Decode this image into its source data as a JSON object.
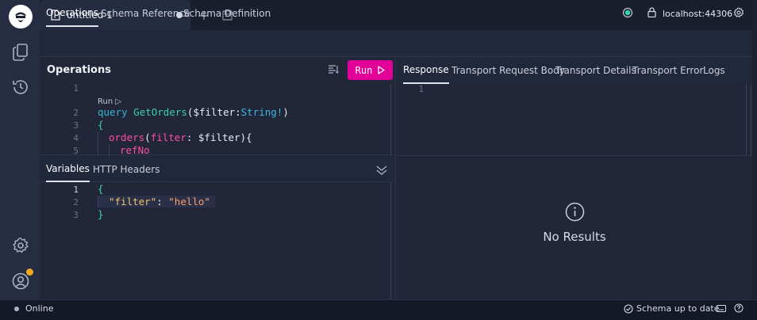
{
  "tab": {
    "title": "untitled 1"
  },
  "top_actions": {
    "add": "+",
    "more": "◦◦◦"
  },
  "subtabs": [
    "Operations",
    "Schema Reference",
    "Schema Definition"
  ],
  "connection": {
    "url": "localhost:44306"
  },
  "operations": {
    "title": "Operations",
    "run_label": "Run",
    "codelens": "Run ▷",
    "lines": [
      "1",
      "2",
      "3",
      "4",
      "5"
    ],
    "code": {
      "kw_query": "query",
      "op_name": "GetOrders",
      "paren_open": "(",
      "var_name": "$filter",
      "colon": ":",
      "type_name": "String!",
      "paren_close": ")",
      "brace_open": "{",
      "field_orders": "orders",
      "arg_open": "(",
      "arg_name": "filter",
      "arg_colon": ": ",
      "arg_var": "$filter",
      "arg_close": "){",
      "field_refno": "refNo"
    }
  },
  "variables": {
    "tabs": [
      "Variables",
      "HTTP Headers"
    ],
    "lines": [
      "1",
      "2",
      "3"
    ],
    "open": "{",
    "key": "\"filter\"",
    "sep": ": ",
    "value": "\"hello\"",
    "close": "}"
  },
  "response": {
    "tabs": [
      "Response",
      "Transport Request Body",
      "Transport Details",
      "Transport Error",
      "Logs"
    ],
    "line": "1",
    "empty_message": "No Results"
  },
  "status": {
    "online": "Online",
    "schema": "Schema up to date"
  },
  "colors": {
    "accent": "#e10098",
    "status_green": "#3ad3a8",
    "notification": "#f5a623"
  }
}
